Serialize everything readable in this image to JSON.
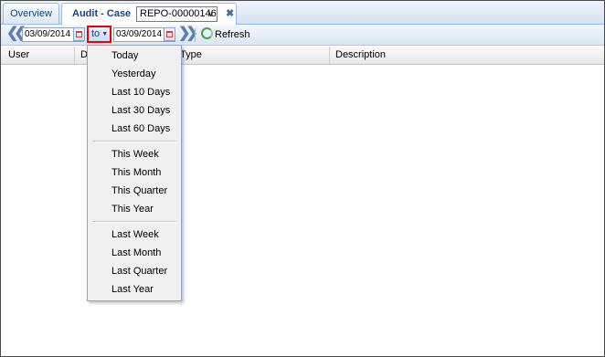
{
  "tabs": {
    "overview_label": "Overview",
    "audit_label": "Audit - Case",
    "record_value": "REPO-00000146",
    "close_glyph": "✖"
  },
  "toolbar": {
    "from_date": "03/09/2014",
    "range_label": "to",
    "to_date": "03/09/2014",
    "refresh_label": "Refresh"
  },
  "grid": {
    "columns": [
      "User",
      "D",
      "Type",
      "Description"
    ]
  },
  "menu": {
    "group1": [
      "Today",
      "Yesterday",
      "Last 10 Days",
      "Last 30 Days",
      "Last 60 Days"
    ],
    "group2": [
      "This Week",
      "This Month",
      "This Quarter",
      "This Year"
    ],
    "group3": [
      "Last Week",
      "Last Month",
      "Last Quarter",
      "Last Year"
    ]
  },
  "colors": {
    "highlight_border": "#e8000f",
    "tab_text": "#15428b"
  }
}
